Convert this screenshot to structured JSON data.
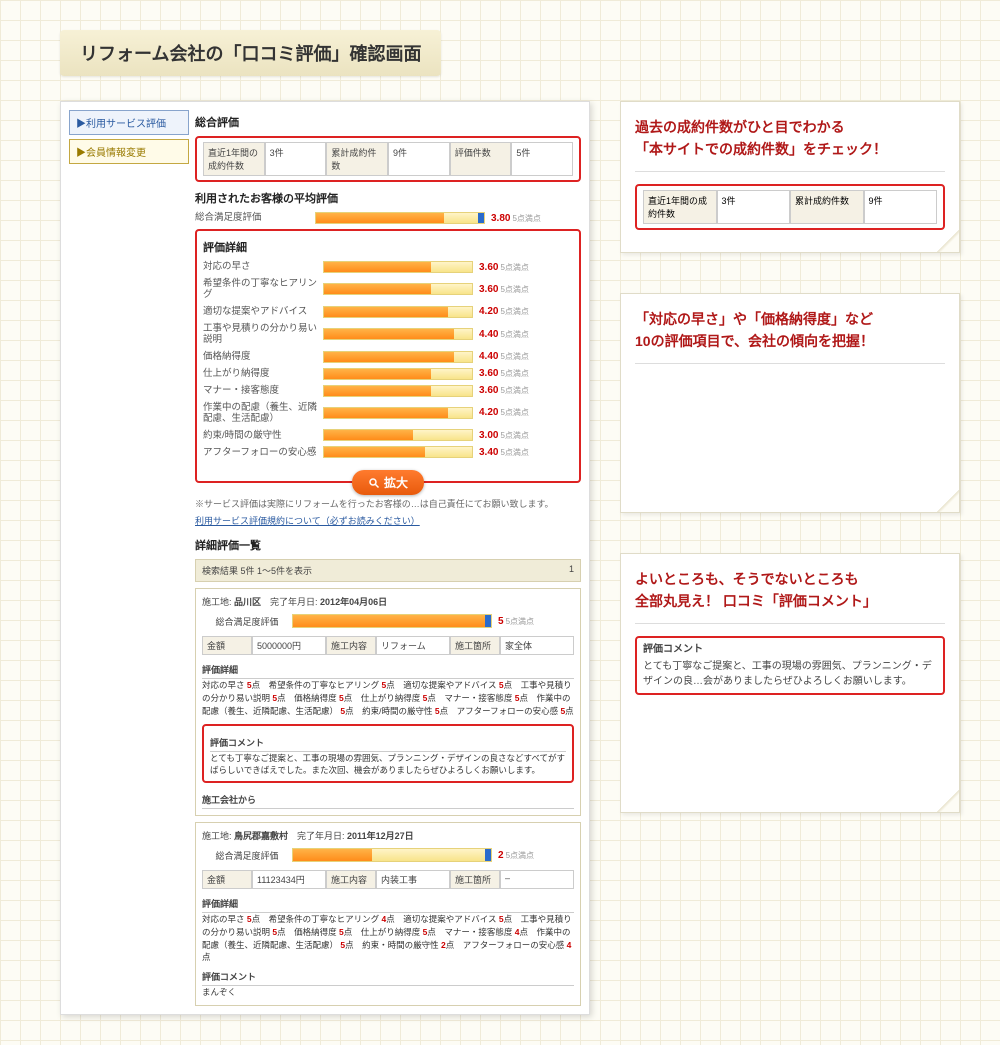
{
  "page_title": "リフォーム会社の「口コミ評価」確認画面",
  "sidebar": {
    "link1": "▶利用サービス評価",
    "link2": "▶会員情報変更"
  },
  "section_overall": "総合評価",
  "stats": {
    "h1": "直近1年間の成約件数",
    "v1": "3件",
    "h2": "累計成約件数",
    "v2": "9件",
    "h3": "評価件数",
    "v3": "5件"
  },
  "avg_title": "利用されたお客様の平均評価",
  "overall": {
    "label": "総合満足度評価",
    "score": "3.80",
    "max": "5点満点"
  },
  "detail_title": "評価詳細",
  "ratings": [
    {
      "label": "対応の早さ",
      "score": "3.60",
      "pct": 72
    },
    {
      "label": "希望条件の丁寧なヒアリング",
      "score": "3.60",
      "pct": 72
    },
    {
      "label": "適切な提案やアドバイス",
      "score": "4.20",
      "pct": 84
    },
    {
      "label": "工事や見積りの分かり易い説明",
      "score": "4.40",
      "pct": 88
    },
    {
      "label": "価格納得度",
      "score": "4.40",
      "pct": 88
    },
    {
      "label": "仕上がり納得度",
      "score": "3.60",
      "pct": 72
    },
    {
      "label": "マナー・接客態度",
      "score": "3.60",
      "pct": 72
    },
    {
      "label": "作業中の配慮（養生、近隣配慮、生活配慮）",
      "score": "4.20",
      "pct": 84
    },
    {
      "label": "約束/時間の厳守性",
      "score": "3.00",
      "pct": 60
    },
    {
      "label": "アフターフォローの安心感",
      "score": "3.40",
      "pct": 68
    }
  ],
  "rating_max": "5点満点",
  "zoom": "拡大",
  "note": "※サービス評価は実際にリフォームを行ったお客様の…は自己責任にてお願い致します。",
  "note_link": "利用サービス評価規約について（必ずお読みください）",
  "list_title": "詳細評価一覧",
  "list_header": {
    "left": "検索結果 5件 1〜5件を表示",
    "right": "1"
  },
  "reviews": [
    {
      "loc_h": "施工地:",
      "loc": "品川区",
      "date_h": "完了年月日:",
      "date": "2012年04月06日",
      "overall_label": "総合満足度評価",
      "overall_score": "5",
      "overall_max": "5点満点",
      "pct": 100,
      "tbl": {
        "h1": "金額",
        "v1": "5000000円",
        "h2": "施工内容",
        "v2": "リフォーム",
        "h3": "施工箇所",
        "v3": "家全体"
      },
      "detail_hdr": "評価詳細",
      "items": "対応の早さ 5点　希望条件の丁寧なヒアリング 5点　適切な提案やアドバイス 5点　工事や見積りの分かり易い説明 5点　価格納得度 5点　仕上がり納得度 5点　マナー・接客態度 5点　作業中の配慮（養生、近隣配慮、生活配慮） 5点　約束/時間の厳守性 5点　アフターフォローの安心感 5点",
      "comment_hdr": "評価コメント",
      "comment": "とても丁寧なご提案と、工事の現場の雰囲気、プランニング・デザインの良さなどすべてがすばらしいできばえでした。また次回、機会がありましたらぜひよろしくお願いします。",
      "from_hdr": "施工会社から"
    },
    {
      "loc_h": "施工地:",
      "loc": "鳥尻郡嘉敷村",
      "date_h": "完了年月日:",
      "date": "2011年12月27日",
      "overall_label": "総合満足度評価",
      "overall_score": "2",
      "overall_max": "5点満点",
      "pct": 40,
      "tbl": {
        "h1": "金額",
        "v1": "11123434円",
        "h2": "施工内容",
        "v2": "内装工事",
        "h3": "施工箇所",
        "v3": "–"
      },
      "detail_hdr": "評価詳細",
      "items": "対応の早さ 5点　希望条件の丁寧なヒアリング 4点　適切な提案やアドバイス 5点　工事や見積りの分かり易い説明 5点　価格納得度 5点　仕上がり納得度 5点　マナー・接客態度 4点　作業中の配慮（養生、近隣配慮、生活配慮） 5点　約束・時間の厳守性 2点　アフターフォローの安心感 4点",
      "comment_hdr": "評価コメント",
      "comment": "まんぞく"
    }
  ],
  "callouts": {
    "c1": {
      "title1": "過去の成約件数がひと目でわかる",
      "title2": "「本サイトでの成約件数」をチェック！",
      "stats": {
        "h1": "直近1年間の成約件数",
        "v1": "3件",
        "h2": "累計成約件数",
        "v2": "9件"
      }
    },
    "c2": {
      "title1": "「対応の早さ」や「価格納得度」など",
      "title2": "10の評価項目で、会社の傾向を把握！"
    },
    "c3": {
      "title1": "よいところも、そうでないところも",
      "title2": "全部丸見え！ 口コミ「評価コメント」",
      "comment_hdr": "評価コメント",
      "comment": "とても丁寧なご提案と、工事の現場の雰囲気、プランニング・デザインの良…会がありましたらぜひよろしくお願いします。"
    }
  }
}
